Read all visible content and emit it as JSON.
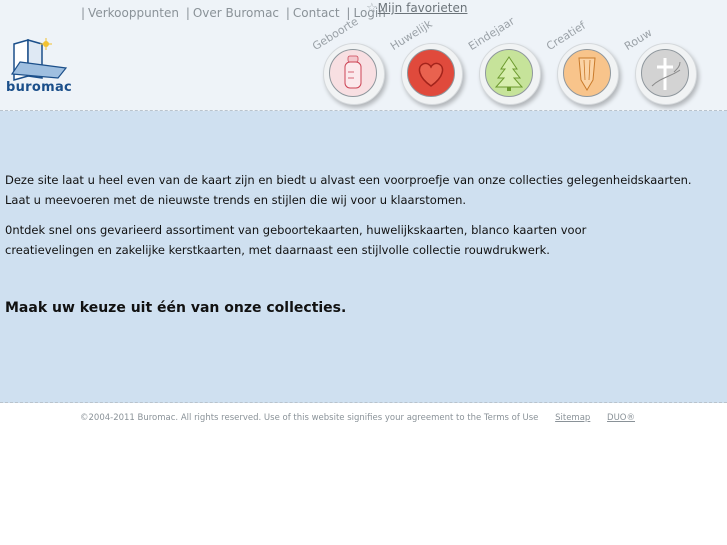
{
  "topnav": {
    "items": [
      "Verkooppunten",
      "Over Buromac",
      "Contact",
      "Login"
    ],
    "favorites": "Mijn favorieten"
  },
  "logo": {
    "text": "buromac"
  },
  "collections": [
    {
      "name": "Geboorte",
      "icon": "baby-bottle-icon",
      "color": "#f3c6cc"
    },
    {
      "name": "Huwelijk",
      "icon": "heart-icon",
      "color": "#e04a3c"
    },
    {
      "name": "Eindejaar",
      "icon": "christmas-tree-icon",
      "color": "#b9dc7c"
    },
    {
      "name": "Creatief",
      "icon": "pencil-icon",
      "color": "#f7b36d"
    },
    {
      "name": "Rouw",
      "icon": "cross-icon",
      "color": "#c9c9c9"
    }
  ],
  "intro": {
    "line1": "Deze site laat u heel even van de kaart zijn en biedt u alvast een voorproefje van onze collecties gelegenheidskaarten.",
    "line2": "Laat u meevoeren met de nieuwste trends en stijlen die wij voor u klaarstomen.",
    "line3": "0ntdek snel ons gevarieerd assortiment van geboortekaarten, huwelijkskaarten, blanco kaarten voor",
    "line4": "creatievelingen en zakelijke kerstkaarten, met daarnaast een stijlvolle collectie rouwdrukwerk.",
    "cta": "Maak uw keuze uit één van onze collecties."
  },
  "footer": {
    "copyright": "©2004-2011 Buromac. All rights reserved. Use of this website signifies your agreement to the Terms of Use",
    "sitemap": "Sitemap",
    "duo": "DUO®"
  }
}
